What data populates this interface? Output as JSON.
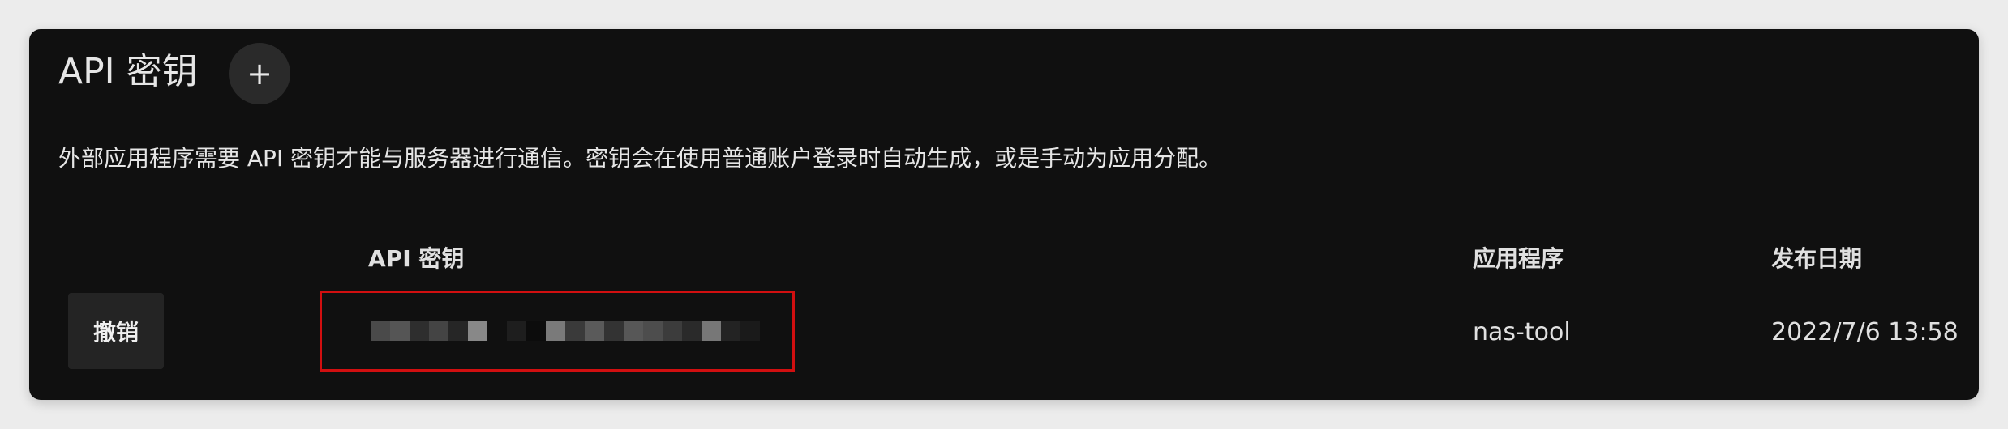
{
  "header": {
    "title": "API 密钥",
    "add_icon": "plus-icon",
    "add_glyph": "+"
  },
  "description": "外部应用程序需要 API 密钥才能与服务器进行通信。密钥会在使用普通账户登录时自动生成，或是手动为应用分配。",
  "table": {
    "columns": [
      "API 密钥",
      "应用程序",
      "发布日期"
    ],
    "rows": [
      {
        "revoke_label": "撤销",
        "api_key": "",
        "app_name": "nas-tool",
        "date_issued": "2022/7/6 13:58"
      }
    ]
  },
  "colors": {
    "panel_bg": "#101010",
    "page_bg": "#ececec",
    "highlight_border": "#d10f10"
  }
}
